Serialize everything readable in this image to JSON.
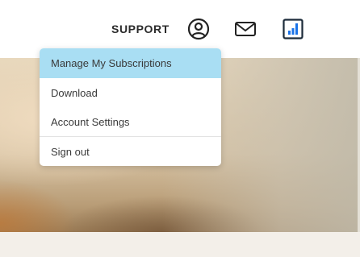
{
  "header": {
    "support_label": "SUPPORT",
    "icons": [
      "account-circle-icon",
      "mail-icon",
      "dashboard-icon"
    ],
    "accent_color": "#1a73e8"
  },
  "account_menu": {
    "items": [
      {
        "label": "Manage My Subscriptions",
        "highlighted": true
      },
      {
        "label": "Download"
      },
      {
        "label": "Account Settings"
      },
      {
        "label": "Sign out"
      }
    ],
    "highlight_color": "#a9def3"
  }
}
